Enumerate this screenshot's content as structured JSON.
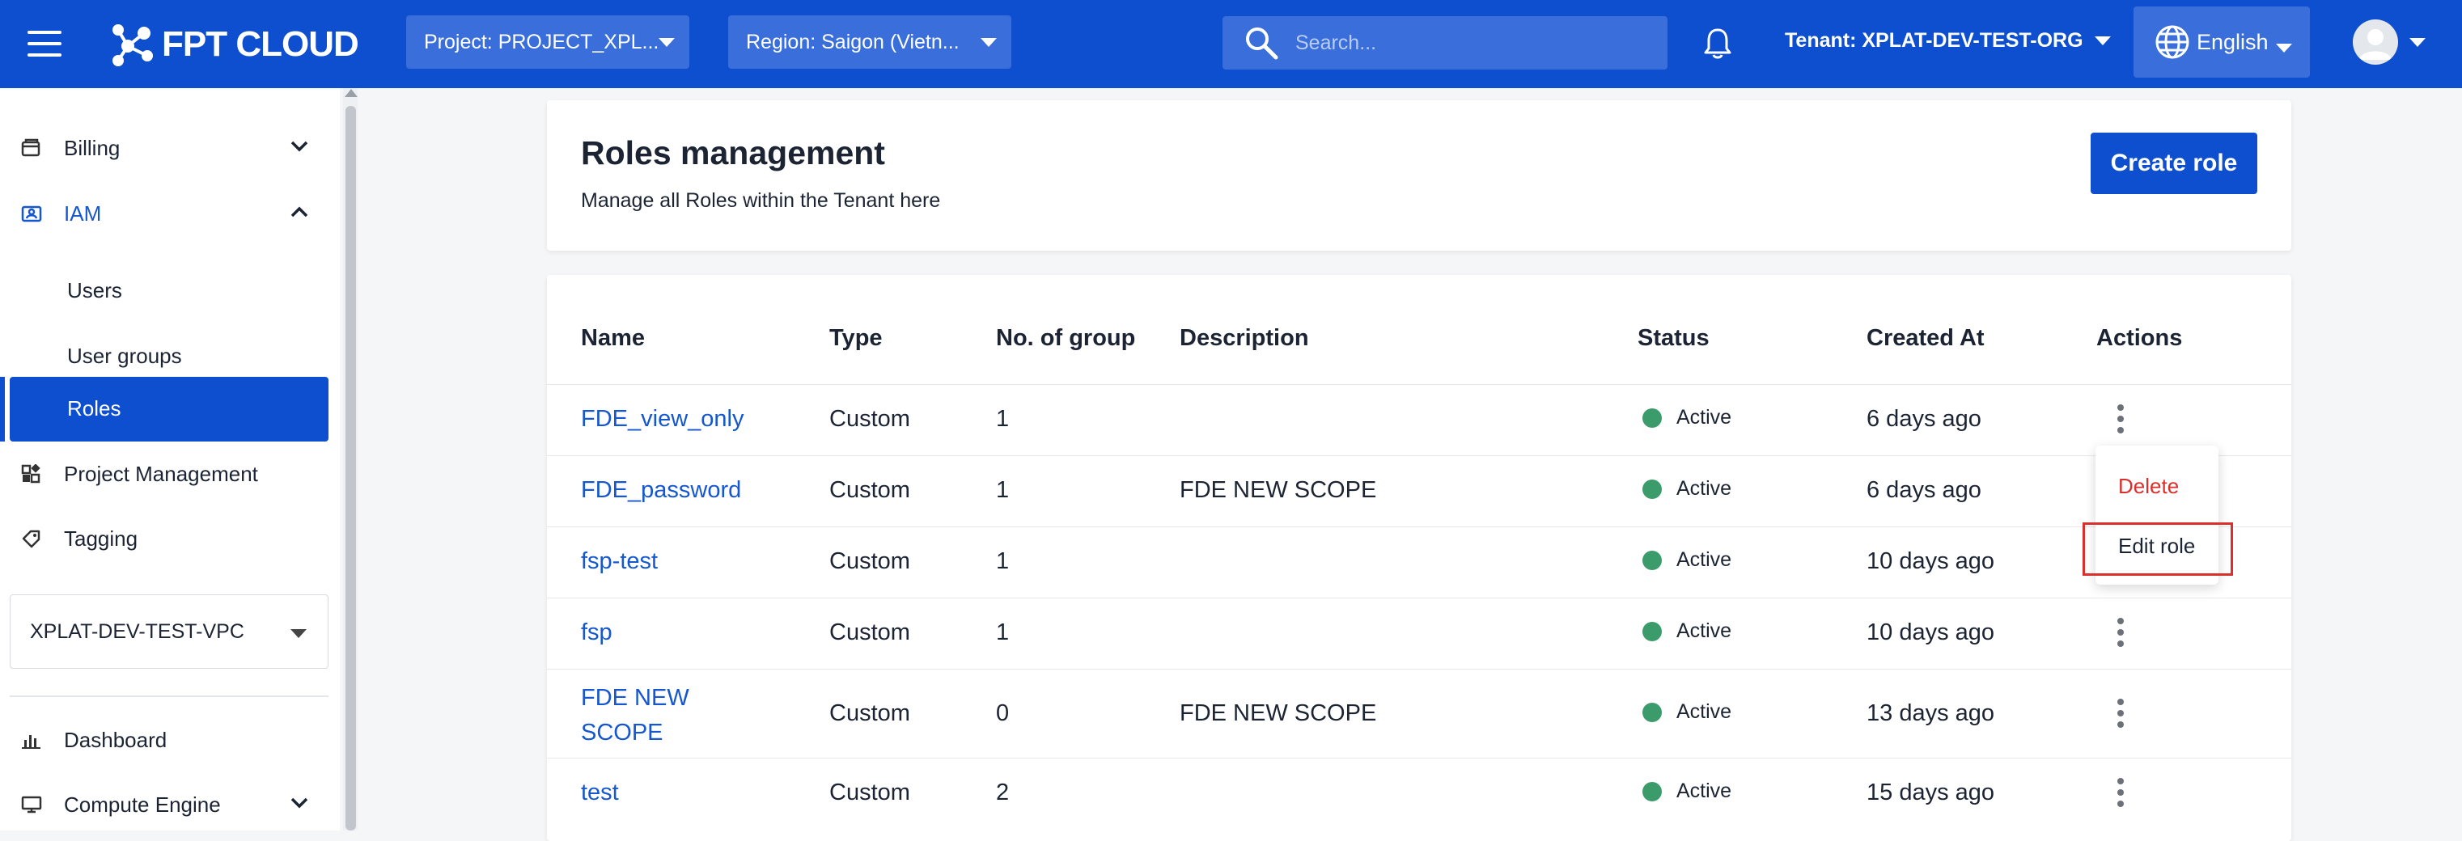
{
  "header": {
    "logo_text": "FPT CLOUD",
    "project_select": "Project: PROJECT_XPL...",
    "region_select": "Region: Saigon (Vietn...",
    "search_placeholder": "Search...",
    "tenant": "Tenant: XPLAT-DEV-TEST-ORG",
    "language": "English"
  },
  "sidebar": {
    "items": [
      {
        "label": "Billing",
        "icon": "billing-icon",
        "expanded": false
      },
      {
        "label": "IAM",
        "icon": "iam-icon",
        "expanded": true
      },
      {
        "label": "Project Management",
        "icon": "project-management-icon"
      },
      {
        "label": "Tagging",
        "icon": "tag-icon"
      }
    ],
    "iam_children": [
      "Users",
      "User groups",
      "Roles"
    ],
    "active_child": "Roles",
    "vpc_select": "XPLAT-DEV-TEST-VPC",
    "bottom_items": [
      {
        "label": "Dashboard",
        "icon": "dashboard-icon"
      },
      {
        "label": "Compute Engine",
        "icon": "compute-engine-icon",
        "expanded": false
      }
    ]
  },
  "page": {
    "title": "Roles management",
    "subtitle": "Manage all Roles within the Tenant here",
    "create_button": "Create role"
  },
  "table": {
    "columns": [
      "Name",
      "Type",
      "No. of group",
      "Description",
      "Status",
      "Created At",
      "Actions"
    ],
    "rows": [
      {
        "name": "FDE_view_only",
        "type": "Custom",
        "groups": "1",
        "description": "",
        "status": "Active",
        "created": "6 days ago"
      },
      {
        "name": "FDE_password",
        "type": "Custom",
        "groups": "1",
        "description": "FDE NEW SCOPE",
        "status": "Active",
        "created": "6 days ago"
      },
      {
        "name": "fsp-test",
        "type": "Custom",
        "groups": "1",
        "description": "",
        "status": "Active",
        "created": "10 days ago"
      },
      {
        "name": "fsp",
        "type": "Custom",
        "groups": "1",
        "description": "",
        "status": "Active",
        "created": "10 days ago"
      },
      {
        "name_line1": "FDE NEW",
        "name_line2": "SCOPE",
        "type": "Custom",
        "groups": "0",
        "description": "FDE NEW SCOPE",
        "status": "Active",
        "created": "13 days ago"
      },
      {
        "name": "test",
        "type": "Custom",
        "groups": "2",
        "description": "",
        "status": "Active",
        "created": "15 days ago"
      }
    ]
  },
  "action_menu": {
    "open_for_row": 0,
    "items": [
      {
        "label": "Delete",
        "color": "#d9302c"
      },
      {
        "label": "Edit role",
        "color": "#1c2434",
        "highlighted": true
      }
    ]
  },
  "colors": {
    "brand_blue": "#0d4fcf",
    "status_active": "#3c9b6b",
    "link": "#1557d0",
    "danger": "#d9302c"
  }
}
